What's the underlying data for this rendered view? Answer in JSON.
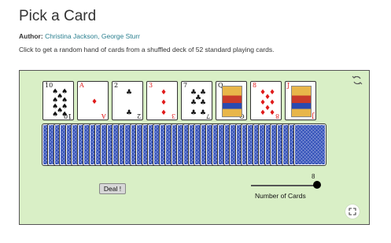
{
  "page": {
    "title": "Pick a Card",
    "author_label": "Author:",
    "authors": "Christina Jackson, George Sturr",
    "description": "Click to get a random hand of cards from a shuffled deck of 52 standard playing cards."
  },
  "hand": [
    {
      "rank": "10",
      "suit": "♠",
      "color": "black"
    },
    {
      "rank": "A",
      "suit": "♦",
      "color": "red"
    },
    {
      "rank": "2",
      "suit": "♣",
      "color": "black"
    },
    {
      "rank": "3",
      "suit": "♦",
      "color": "red"
    },
    {
      "rank": "7",
      "suit": "♣",
      "color": "black"
    },
    {
      "rank": "Q",
      "suit": "♣",
      "color": "black"
    },
    {
      "rank": "8",
      "suit": "♦",
      "color": "red"
    },
    {
      "rank": "J",
      "suit": "♦",
      "color": "red"
    }
  ],
  "controls": {
    "deal_label": "Deal !",
    "slider_value": "8",
    "slider_label": "Number of Cards",
    "slider_fraction": 1.0
  },
  "colors": {
    "panel_bg": "#d9efc6",
    "card_back": "#2f4db8",
    "red_suit": "#e01b1b",
    "link": "#2a7f8f"
  },
  "icons": {
    "refresh": "refresh-icon",
    "fullscreen": "fullscreen-icon"
  }
}
